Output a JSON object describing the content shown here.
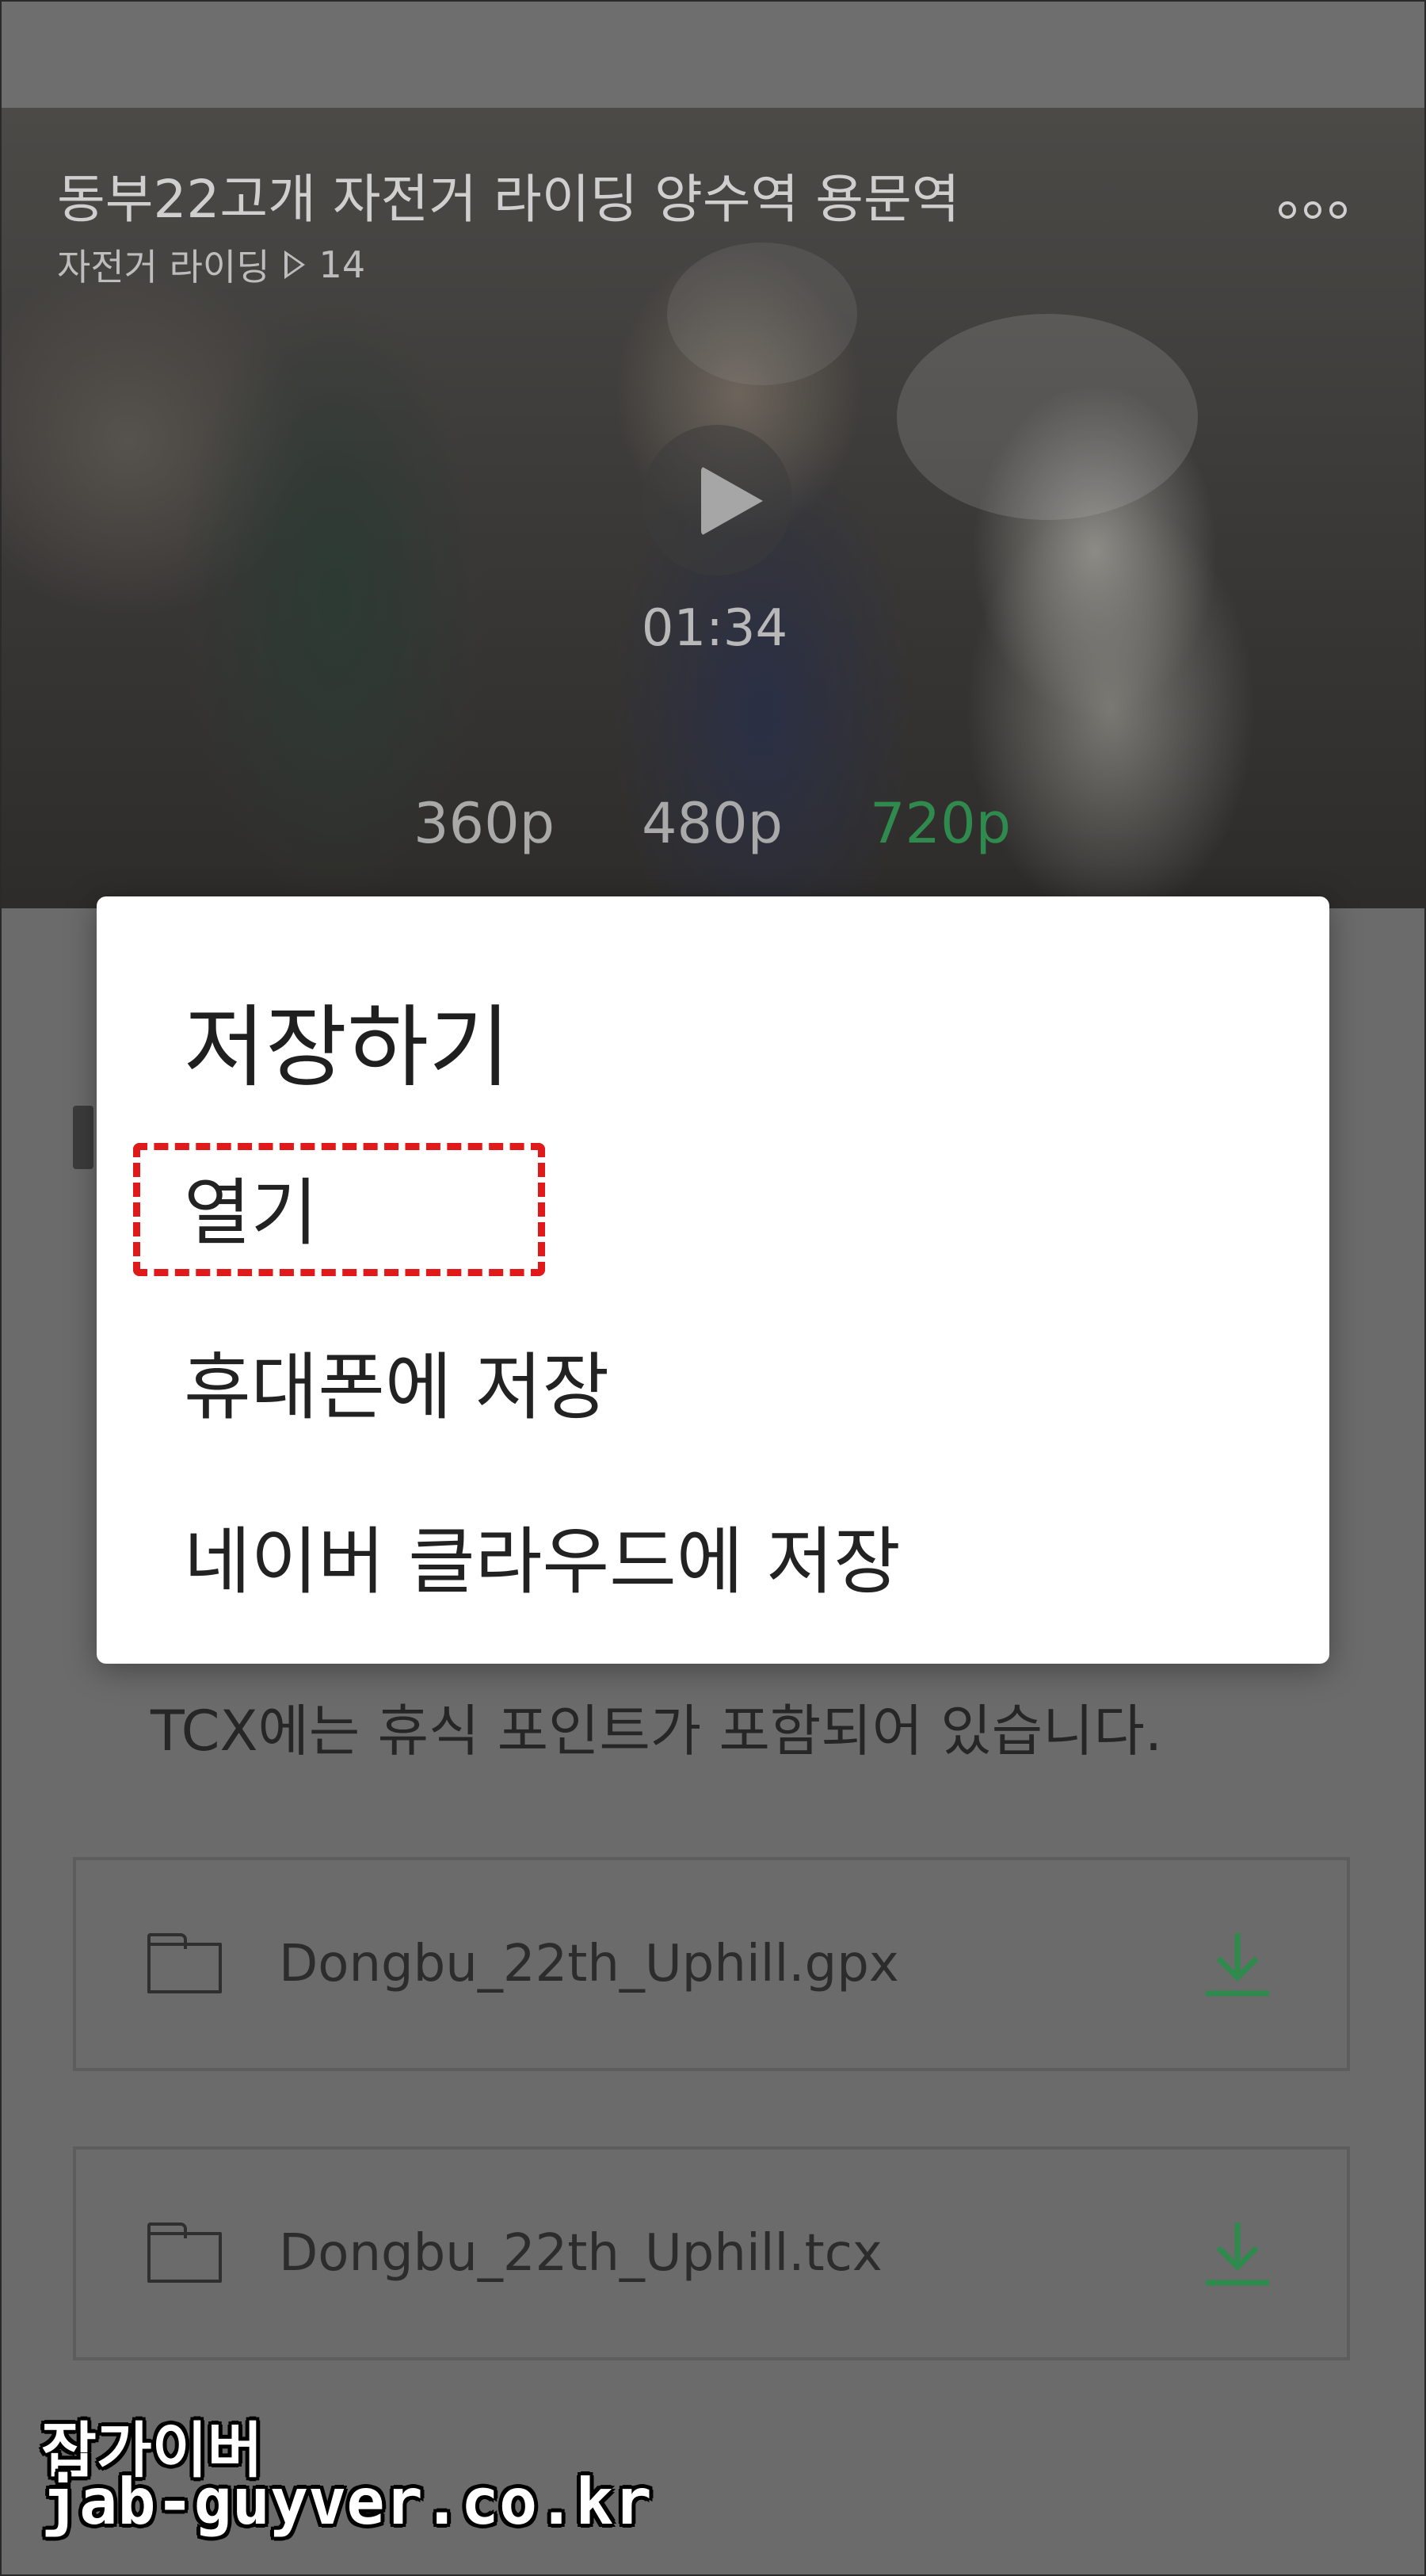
{
  "video": {
    "title": "동부22고개 자전거 라이딩 양수역 용문역",
    "category": "자전거 라이딩",
    "view_count": "14",
    "duration": "01:34",
    "qualities": [
      "360p",
      "480p",
      "720p"
    ],
    "selected_quality": "720p"
  },
  "page": {
    "info_text": "TCX에는 휴식 포인트가 포함되어 있습니다.",
    "files": [
      {
        "name": "Dongbu_22th_Uphill.gpx"
      },
      {
        "name": "Dongbu_22th_Uphill.tcx"
      }
    ]
  },
  "dialog": {
    "title": "저장하기",
    "options": [
      "열기",
      "휴대폰에 저장",
      "네이버 클라우드에 저장"
    ],
    "highlighted_option": "열기"
  },
  "watermark": {
    "line1": "잡가이버",
    "line2": "jab-guyver.co.kr"
  },
  "colors": {
    "accent_green": "#2f8a4d",
    "highlight_red": "#e01a1a"
  }
}
